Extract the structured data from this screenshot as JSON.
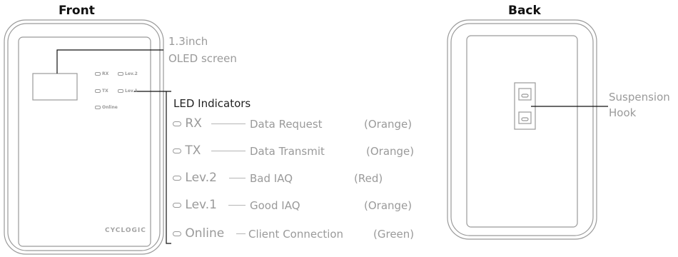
{
  "front": {
    "title": "Front",
    "screen_callout": [
      "1.3inch",
      "OLED screen"
    ],
    "panel_labels": [
      "RX",
      "Lev.2",
      "TX",
      "Lev.1",
      "Online"
    ],
    "brand": "CYCLOGIC"
  },
  "back": {
    "title": "Back",
    "hook_callout": [
      "Suspension",
      "Hook"
    ]
  },
  "led": {
    "heading": "LED Indicators",
    "items": [
      {
        "code": "RX",
        "description": "Data Request",
        "color": "(Orange)"
      },
      {
        "code": "TX",
        "description": "Data Transmit",
        "color": "(Orange)"
      },
      {
        "code": "Lev.2",
        "description": "Bad IAQ",
        "color": "(Red)"
      },
      {
        "code": "Lev.1",
        "description": "Good IAQ",
        "color": "(Orange)"
      },
      {
        "code": "Online",
        "description": "Client Connection",
        "color": "(Green)"
      }
    ]
  },
  "colors": {
    "outline": "#9a9a9a",
    "text_dark": "#111111",
    "text_light": "#9a9a9a"
  }
}
